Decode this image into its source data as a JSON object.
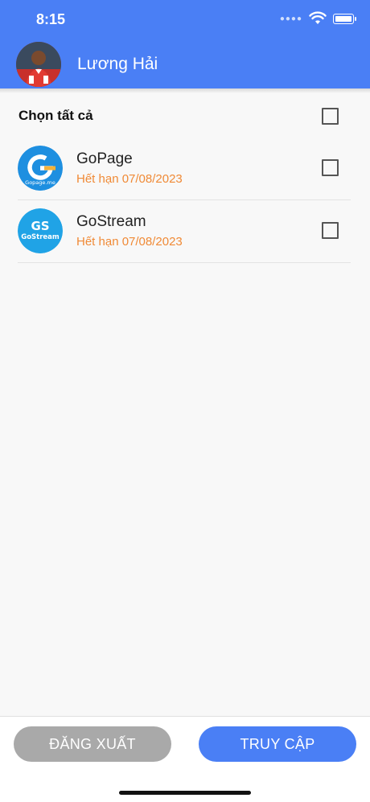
{
  "status_bar": {
    "time": "8:15"
  },
  "header": {
    "user_name": "Lương Hải",
    "avatar_icon": "user-avatar"
  },
  "select_all": {
    "label": "Chọn tất cả",
    "checked": false
  },
  "apps": [
    {
      "name": "GoPage",
      "expiry": "Hết hạn 07/08/2023",
      "logo_text": "Gopage.me",
      "logo_icon": "gopage-logo",
      "checked": false
    },
    {
      "name": "GoStream",
      "expiry": "Hết hạn 07/08/2023",
      "logo_text": "GoStream",
      "logo_icon": "gostream-logo",
      "checked": false
    }
  ],
  "buttons": {
    "logout": "ĐĂNG XUẤT",
    "access": "TRUY CẬP"
  },
  "colors": {
    "primary": "#4a7ff5",
    "expiry": "#f08a36",
    "disabled": "#a9a9a9"
  }
}
